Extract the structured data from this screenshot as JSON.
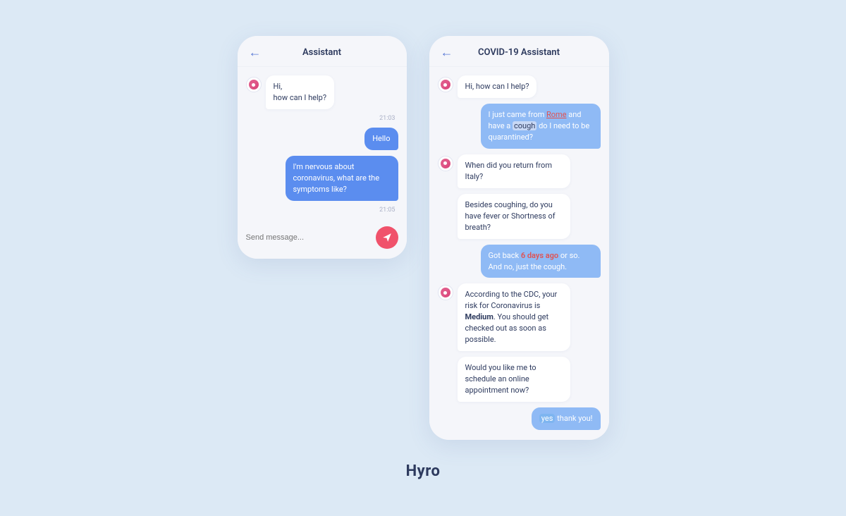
{
  "brand": "Hyro",
  "left_phone": {
    "header": {
      "back": "←",
      "title": "Assistant"
    },
    "messages": [
      {
        "type": "bot",
        "text": "Hi,\nhow can I help?"
      },
      {
        "type": "timestamp",
        "text": "21:03"
      },
      {
        "type": "user",
        "text": "Hello"
      },
      {
        "type": "user",
        "text": "I'm nervous about coronavirus, what are the symptoms like?"
      },
      {
        "type": "timestamp",
        "text": "21:05"
      }
    ],
    "input_placeholder": "Send message..."
  },
  "right_phone": {
    "header": {
      "back": "←",
      "title": "COVID-19 Assistant"
    },
    "messages": [
      {
        "type": "bot",
        "text": "Hi, how can I help?"
      },
      {
        "type": "user_highlighted",
        "parts": [
          {
            "text": "I just came from ",
            "style": "normal"
          },
          {
            "text": "Rome",
            "style": "underline-red"
          },
          {
            "text": " and have a ",
            "style": "normal"
          },
          {
            "text": "cough",
            "style": "highlight-blue"
          },
          {
            "text": " do I need to be quarantined?",
            "style": "normal"
          }
        ]
      },
      {
        "type": "bot",
        "text": "When did you return from Italy?"
      },
      {
        "type": "bot",
        "text": "Besides coughing, do you have fever or Shortness of breath?"
      },
      {
        "type": "user",
        "text": "Got back 6 days ago or so. And no, just the cough.",
        "highlight": "6 days ago"
      },
      {
        "type": "bot",
        "text": "According to the CDC, your risk for Coronavirus is Medium. You should get checked out as soon as possible."
      },
      {
        "type": "bot",
        "text": "Would you like me to schedule an online appointment now?"
      },
      {
        "type": "user_yes",
        "text_yes": "yes",
        "text_rest": " thank you!"
      }
    ]
  }
}
